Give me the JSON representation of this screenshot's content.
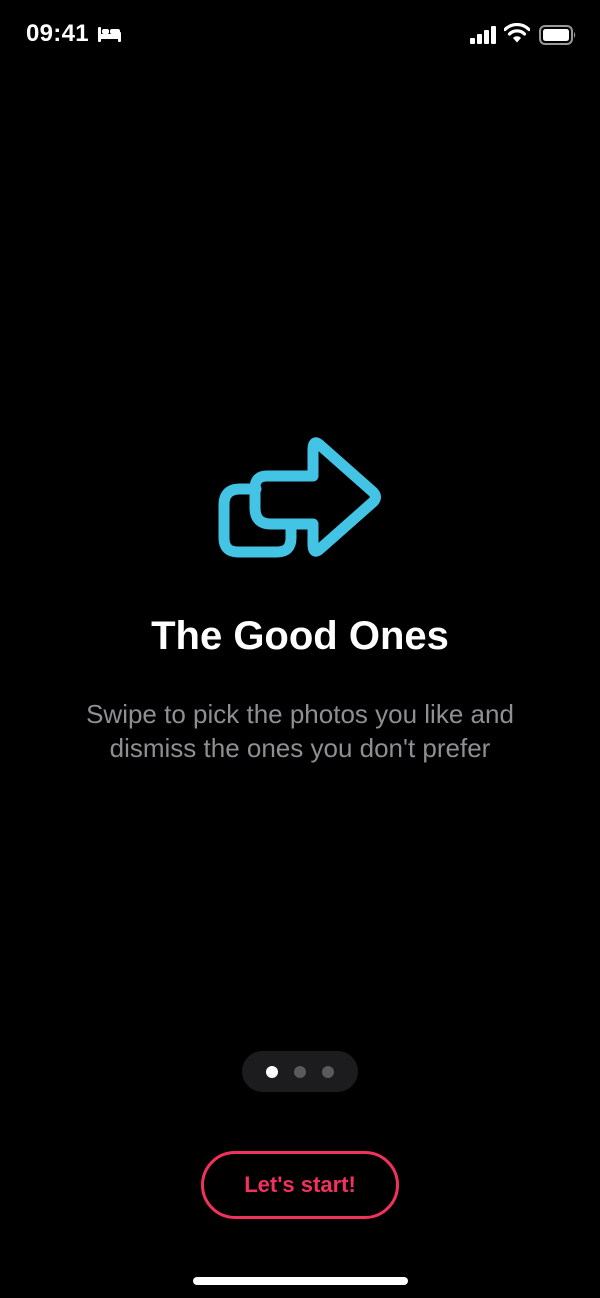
{
  "status_bar": {
    "time": "09:41",
    "icons": [
      "bed-icon",
      "cellular-signal-icon",
      "wifi-icon",
      "battery-icon"
    ]
  },
  "onboarding": {
    "hero_icon": "swipe-arrow-icon",
    "title": "The Good Ones",
    "subtitle_line1": "Swipe to pick the photos you like and",
    "subtitle_line2": "dismiss the ones you don't prefer",
    "page_count": 3,
    "current_page": 1
  },
  "actions": {
    "start_label": "Let's start!"
  },
  "colors": {
    "background": "#000000",
    "accent_icon": "#44c4e4",
    "accent_button": "#f2315d",
    "subtitle": "#8e8e93",
    "pager_bg": "#1c1c1e"
  }
}
